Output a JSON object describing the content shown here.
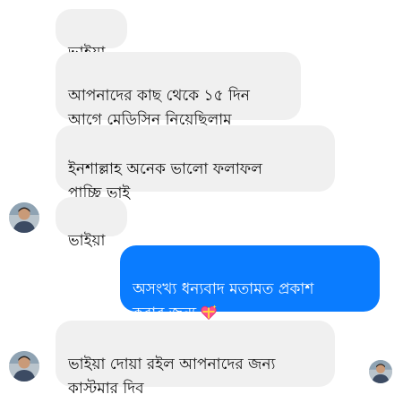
{
  "conversation": {
    "messages": [
      {
        "sender": "contact",
        "text": "ভাইয়া"
      },
      {
        "sender": "contact",
        "text": "আপনাদের কাছ থেকে ১৫ দিন\nআগে  মেডিসিন নিয়েছিলাম"
      },
      {
        "sender": "contact",
        "text": "ইনশাল্লাহ অনেক ভালো ফলাফল\nপাচ্ছি ভাই"
      },
      {
        "sender": "contact",
        "text": "ভাইয়া"
      },
      {
        "sender": "me",
        "text": "অসংখ্য ধন্যবাদ মতামত প্রকাশ\nকরার জন্য",
        "emoji": "sparkling-heart"
      },
      {
        "sender": "contact",
        "text": "ভাইয়া দোয়া রইল আপনাদের জন্য\nকাস্টমার দিব"
      }
    ]
  },
  "colors": {
    "incoming_bubble": "#f0f0f0",
    "outgoing_bubble": "#0a7cff",
    "outgoing_text": "#ffffff",
    "incoming_text": "#111111"
  }
}
